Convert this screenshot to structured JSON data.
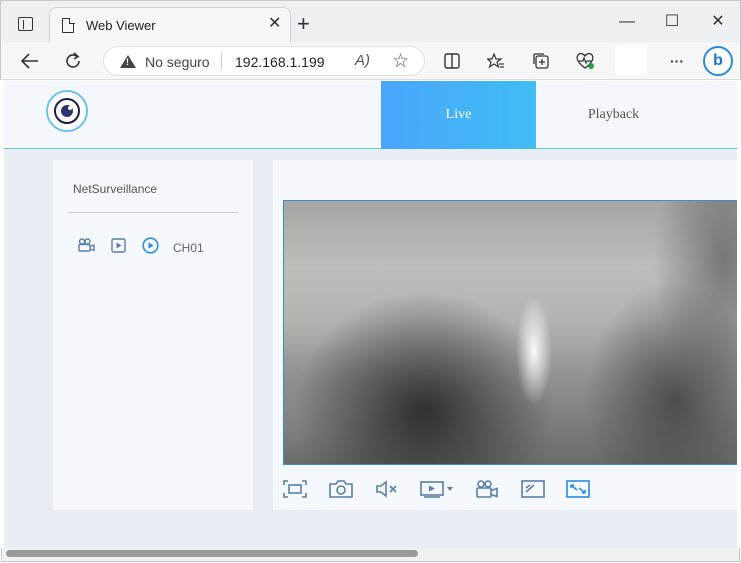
{
  "browser": {
    "tab_title": "Web Viewer",
    "tab_close": "✕",
    "new_tab": "+",
    "window_controls": {
      "minimize": "—",
      "maximize": "☐",
      "close": "✕"
    },
    "security_label": "No seguro",
    "url": "192.168.1.199",
    "read_aloud": "A)",
    "favorite": "☆",
    "menu": "···",
    "copilot": "b"
  },
  "app": {
    "nav_tabs": [
      {
        "label": "Live",
        "active": true
      },
      {
        "label": "Playback",
        "active": false
      }
    ],
    "device_tree": {
      "title": "NetSurveillance",
      "channel_label": "CH01"
    },
    "video_toolbar_icons": [
      "fullscreen-icon",
      "snapshot-icon",
      "mute-icon",
      "stream-select-icon",
      "record-icon",
      "ratio-icon",
      "fit-window-icon"
    ]
  },
  "colors": {
    "accent": "#3fa7f5",
    "page_bg": "#e9edf4",
    "panel_bg": "#f5f8fc",
    "header_line": "#66c7c9",
    "icon_blue": "#5a7fa8",
    "icon_active": "#2b8fe0"
  }
}
